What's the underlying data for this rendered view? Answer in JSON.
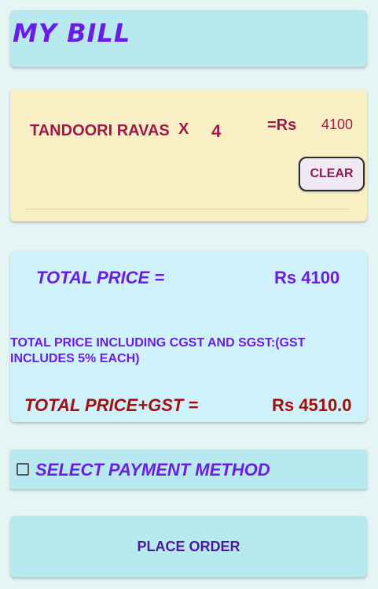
{
  "header": {
    "title": "MY BILL"
  },
  "item": {
    "name": "TANDOORI RAVAS",
    "times": "X",
    "quantity": "4",
    "equals_rs": "=Rs",
    "price": "4100",
    "clear_label": "CLEAR"
  },
  "totals": {
    "total_label": "TOTAL PRICE  =",
    "total_value": "Rs 4100",
    "gst_note": "TOTAL PRICE INCLUDING CGST AND SGST:(GST INCLUDES 5% EACH)",
    "gst_label": "TOTAL PRICE+GST =",
    "gst_value": "Rs 4510.0"
  },
  "payment": {
    "checkbox_checked": false,
    "label": "SELECT PAYMENT METHOD"
  },
  "order": {
    "button_label": "PLACE ORDER"
  },
  "colors": {
    "background": "#e4f5f4",
    "accent_purple": "#6a1de6",
    "item_maroon": "#9c1a4b",
    "gst_red": "#a40e0e",
    "card_cyan": "#b7e9ee",
    "item_card_yellow": "#f8f0c4"
  }
}
